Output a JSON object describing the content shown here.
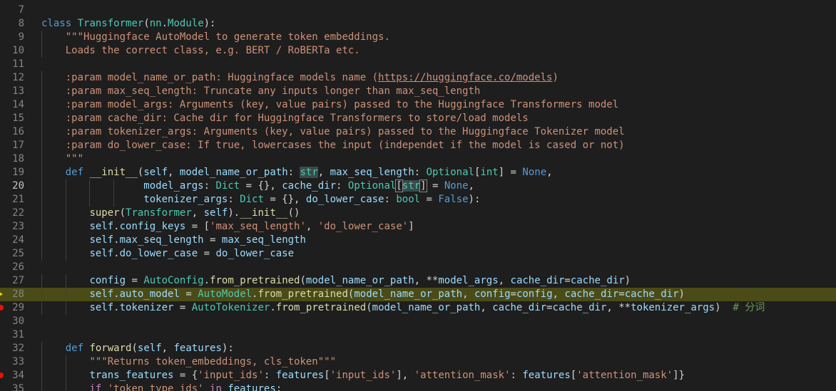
{
  "editor": {
    "colors": {
      "background": "#1e1e1e",
      "current_line_highlight": "#4b4b18",
      "breakpoint": "#e51400",
      "debug_arrow": "#ffcc00"
    },
    "lines": [
      {
        "n": "7",
        "tokens": []
      },
      {
        "n": "8",
        "tokens": [
          [
            "kw",
            "class"
          ],
          [
            "op",
            " "
          ],
          [
            "cls",
            "Transformer"
          ],
          [
            "op",
            "("
          ],
          [
            "cls",
            "nn"
          ],
          [
            "op",
            "."
          ],
          [
            "cls",
            "Module"
          ],
          [
            "op",
            "):"
          ]
        ]
      },
      {
        "n": "9",
        "tokens": [
          [
            "op",
            "    "
          ],
          [
            "str",
            "\"\"\"Huggingface AutoModel to generate token embeddings."
          ]
        ]
      },
      {
        "n": "10",
        "tokens": [
          [
            "op",
            "    "
          ],
          [
            "str",
            "Loads the correct class, e.g. BERT / RoBERTa etc."
          ]
        ]
      },
      {
        "n": "11",
        "tokens": []
      },
      {
        "n": "12",
        "tokens": [
          [
            "op",
            "    "
          ],
          [
            "str",
            ":param model_name_or_path: Huggingface models name ("
          ],
          [
            "str u",
            "https://huggingface.co/models"
          ],
          [
            "str",
            ")"
          ]
        ]
      },
      {
        "n": "13",
        "tokens": [
          [
            "op",
            "    "
          ],
          [
            "str",
            ":param max_seq_length: Truncate any inputs longer than max_seq_length"
          ]
        ]
      },
      {
        "n": "14",
        "tokens": [
          [
            "op",
            "    "
          ],
          [
            "str",
            ":param model_args: Arguments (key, value pairs) passed to the Huggingface Transformers model"
          ]
        ]
      },
      {
        "n": "15",
        "tokens": [
          [
            "op",
            "    "
          ],
          [
            "str",
            ":param cache_dir: Cache dir for Huggingface Transformers to store/load models"
          ]
        ]
      },
      {
        "n": "16",
        "tokens": [
          [
            "op",
            "    "
          ],
          [
            "str",
            ":param tokenizer_args: Arguments (key, value pairs) passed to the Huggingface Tokenizer model"
          ]
        ]
      },
      {
        "n": "17",
        "tokens": [
          [
            "op",
            "    "
          ],
          [
            "str",
            ":param do_lower_case: If true, lowercases the input (independet if the model is cased or not)"
          ]
        ]
      },
      {
        "n": "18",
        "tokens": [
          [
            "op",
            "    "
          ],
          [
            "str",
            "\"\"\""
          ]
        ]
      },
      {
        "n": "19",
        "tokens": [
          [
            "op",
            "    "
          ],
          [
            "kw",
            "def"
          ],
          [
            "op",
            " "
          ],
          [
            "fn",
            "__init__"
          ],
          [
            "op",
            "("
          ],
          [
            "var",
            "self"
          ],
          [
            "op",
            ", "
          ],
          [
            "var",
            "model_name_or_path"
          ],
          [
            "op",
            ": "
          ],
          [
            "cls hlw",
            "str"
          ],
          [
            "op",
            ", "
          ],
          [
            "var",
            "max_seq_length"
          ],
          [
            "op",
            ": "
          ],
          [
            "cls",
            "Optional"
          ],
          [
            "op",
            "["
          ],
          [
            "cls",
            "int"
          ],
          [
            "op",
            "] = "
          ],
          [
            "kw",
            "None"
          ],
          [
            "op",
            ","
          ]
        ]
      },
      {
        "n": "20",
        "current": true,
        "tokens": [
          [
            "op",
            "                 "
          ],
          [
            "var",
            "model_args"
          ],
          [
            "op",
            ": "
          ],
          [
            "cls",
            "Dict"
          ],
          [
            "op",
            " = {}, "
          ],
          [
            "var",
            "cache_dir"
          ],
          [
            "op",
            ": "
          ],
          [
            "cls",
            "Optional"
          ],
          [
            "op bracket",
            "["
          ],
          [
            "cls hlw",
            "str"
          ],
          [
            "op bracket",
            "]"
          ],
          [
            "op",
            " = "
          ],
          [
            "kw",
            "None"
          ],
          [
            "op",
            ","
          ]
        ]
      },
      {
        "n": "21",
        "tokens": [
          [
            "op",
            "                 "
          ],
          [
            "var",
            "tokenizer_args"
          ],
          [
            "op",
            ": "
          ],
          [
            "cls",
            "Dict"
          ],
          [
            "op",
            " = {}, "
          ],
          [
            "var",
            "do_lower_case"
          ],
          [
            "op",
            ": "
          ],
          [
            "cls",
            "bool"
          ],
          [
            "op",
            " = "
          ],
          [
            "kw",
            "False"
          ],
          [
            "op",
            "):"
          ]
        ]
      },
      {
        "n": "22",
        "tokens": [
          [
            "op",
            "        "
          ],
          [
            "fn",
            "super"
          ],
          [
            "op",
            "("
          ],
          [
            "cls",
            "Transformer"
          ],
          [
            "op",
            ", "
          ],
          [
            "var",
            "self"
          ],
          [
            "op",
            ")."
          ],
          [
            "fn",
            "__init__"
          ],
          [
            "op",
            "()"
          ]
        ]
      },
      {
        "n": "23",
        "tokens": [
          [
            "op",
            "        "
          ],
          [
            "var",
            "self"
          ],
          [
            "op",
            "."
          ],
          [
            "var",
            "config_keys"
          ],
          [
            "op",
            " = ["
          ],
          [
            "str",
            "'max_seq_length'"
          ],
          [
            "op",
            ", "
          ],
          [
            "str",
            "'do_lower_case'"
          ],
          [
            "op",
            "]"
          ]
        ]
      },
      {
        "n": "24",
        "tokens": [
          [
            "op",
            "        "
          ],
          [
            "var",
            "self"
          ],
          [
            "op",
            "."
          ],
          [
            "var",
            "max_seq_length"
          ],
          [
            "op",
            " = "
          ],
          [
            "var",
            "max_seq_length"
          ]
        ]
      },
      {
        "n": "25",
        "tokens": [
          [
            "op",
            "        "
          ],
          [
            "var",
            "self"
          ],
          [
            "op",
            "."
          ],
          [
            "var",
            "do_lower_case"
          ],
          [
            "op",
            " = "
          ],
          [
            "var",
            "do_lower_case"
          ]
        ]
      },
      {
        "n": "26",
        "tokens": []
      },
      {
        "n": "27",
        "tokens": [
          [
            "op",
            "        "
          ],
          [
            "var",
            "config"
          ],
          [
            "op",
            " = "
          ],
          [
            "cls",
            "AutoConfig"
          ],
          [
            "op",
            "."
          ],
          [
            "fn",
            "from_pretrained"
          ],
          [
            "op",
            "("
          ],
          [
            "var",
            "model_name_or_path"
          ],
          [
            "op",
            ", **"
          ],
          [
            "var",
            "model_args"
          ],
          [
            "op",
            ", "
          ],
          [
            "var",
            "cache_dir"
          ],
          [
            "op",
            "="
          ],
          [
            "var",
            "cache_dir"
          ],
          [
            "op",
            ")"
          ]
        ]
      },
      {
        "n": "28",
        "highlight": true,
        "arrow": true,
        "tokens": [
          [
            "op",
            "        "
          ],
          [
            "var",
            "self"
          ],
          [
            "op",
            "."
          ],
          [
            "var",
            "auto_model"
          ],
          [
            "op",
            " = "
          ],
          [
            "cls",
            "AutoModel"
          ],
          [
            "op",
            "."
          ],
          [
            "fn",
            "from_pretrained"
          ],
          [
            "op",
            "("
          ],
          [
            "var",
            "model_name_or_path"
          ],
          [
            "op",
            ", "
          ],
          [
            "var",
            "config"
          ],
          [
            "op",
            "="
          ],
          [
            "var",
            "config"
          ],
          [
            "op",
            ", "
          ],
          [
            "var",
            "cache_dir"
          ],
          [
            "op",
            "="
          ],
          [
            "var",
            "cache_dir"
          ],
          [
            "op",
            ")"
          ]
        ]
      },
      {
        "n": "29",
        "breakpoint": true,
        "tokens": [
          [
            "op",
            "        "
          ],
          [
            "var",
            "self"
          ],
          [
            "op",
            "."
          ],
          [
            "var",
            "tokenizer"
          ],
          [
            "op",
            " = "
          ],
          [
            "cls",
            "AutoTokenizer"
          ],
          [
            "op",
            "."
          ],
          [
            "fn",
            "from_pretrained"
          ],
          [
            "op",
            "("
          ],
          [
            "var",
            "model_name_or_path"
          ],
          [
            "op",
            ", "
          ],
          [
            "var",
            "cache_dir"
          ],
          [
            "op",
            "="
          ],
          [
            "var",
            "cache_dir"
          ],
          [
            "op",
            ", **"
          ],
          [
            "var",
            "tokenizer_args"
          ],
          [
            "op",
            ")  "
          ],
          [
            "cmt",
            "# 分词"
          ]
        ]
      },
      {
        "n": "30",
        "tokens": []
      },
      {
        "n": "31",
        "tokens": []
      },
      {
        "n": "32",
        "tokens": [
          [
            "op",
            "    "
          ],
          [
            "kw",
            "def"
          ],
          [
            "op",
            " "
          ],
          [
            "fn",
            "forward"
          ],
          [
            "op",
            "("
          ],
          [
            "var",
            "self"
          ],
          [
            "op",
            ", "
          ],
          [
            "var",
            "features"
          ],
          [
            "op",
            "):"
          ]
        ]
      },
      {
        "n": "33",
        "tokens": [
          [
            "op",
            "        "
          ],
          [
            "str",
            "\"\"\"Returns token_embeddings, cls_token\"\"\""
          ]
        ]
      },
      {
        "n": "34",
        "breakpoint": true,
        "tokens": [
          [
            "op",
            "        "
          ],
          [
            "var",
            "trans_features"
          ],
          [
            "op",
            " = {"
          ],
          [
            "str",
            "'input_ids'"
          ],
          [
            "op",
            ": "
          ],
          [
            "var",
            "features"
          ],
          [
            "op",
            "["
          ],
          [
            "str",
            "'input_ids'"
          ],
          [
            "op",
            "], "
          ],
          [
            "str",
            "'attention_mask'"
          ],
          [
            "op",
            ": "
          ],
          [
            "var",
            "features"
          ],
          [
            "op",
            "["
          ],
          [
            "str",
            "'attention_mask'"
          ],
          [
            "op",
            "]}"
          ]
        ]
      },
      {
        "n": "35",
        "tokens": [
          [
            "op",
            "        "
          ],
          [
            "ctl",
            "if"
          ],
          [
            "op",
            " "
          ],
          [
            "str",
            "'token_type_ids'"
          ],
          [
            "op",
            " "
          ],
          [
            "ctl",
            "in"
          ],
          [
            "op",
            " "
          ],
          [
            "var",
            "features"
          ],
          [
            "op",
            ":"
          ]
        ]
      }
    ]
  }
}
